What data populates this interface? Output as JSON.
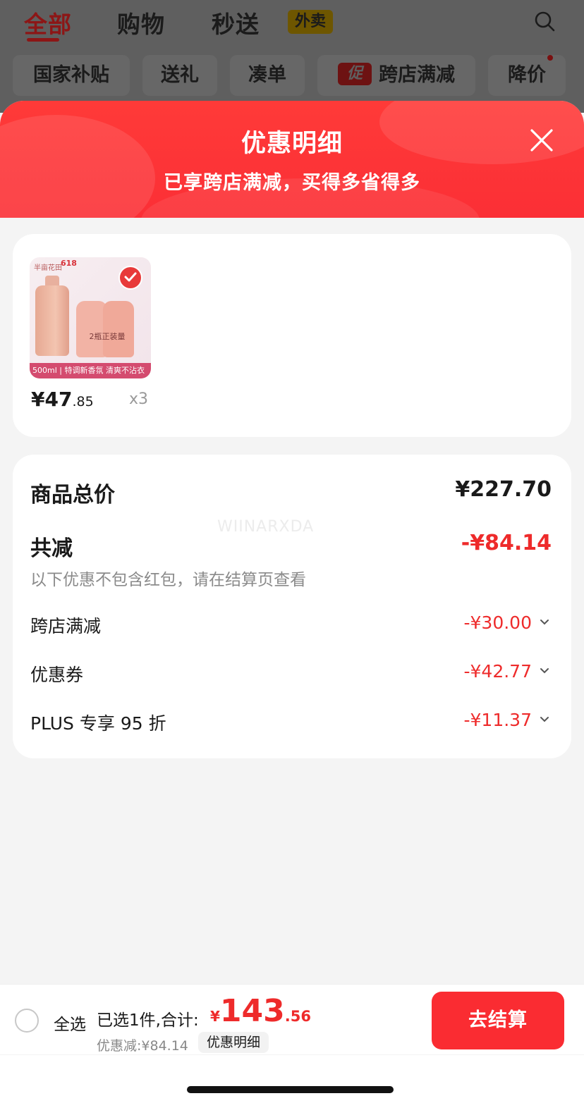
{
  "top_tabs": [
    {
      "label": "全部"
    },
    {
      "label": "购物"
    },
    {
      "label": "秒送"
    }
  ],
  "tab_badge": "外卖",
  "chips": [
    {
      "label": "国家补贴"
    },
    {
      "label": "送礼"
    },
    {
      "label": "凑单"
    },
    {
      "label": "跨店满减",
      "tag": "促"
    },
    {
      "label": "降价"
    }
  ],
  "sheet": {
    "title": "优惠明细",
    "subtitle": "已享跨店满减，买得多省得多"
  },
  "product": {
    "image_text": {
      "brand": "半亩花田",
      "promo": "618",
      "mid": "2瓶正装量",
      "bar": "500ml | 特调新香氛 清爽不沾衣"
    },
    "price_int": "¥47",
    "price_dec": ".85",
    "quantity": "x3"
  },
  "summary": {
    "total_label": "商品总价",
    "total_value": "¥227.70",
    "reduce_label": "共减",
    "reduce_value": "-¥84.14",
    "note": "以下优惠不包含红包，请在结算页查看",
    "watermark": "WIINARXDA",
    "details": [
      {
        "label": "跨店满减",
        "value": "-¥30.00"
      },
      {
        "label": "优惠券",
        "value": "-¥42.77"
      },
      {
        "label": "PLUS 专享 95 折",
        "value": "-¥11.37"
      }
    ]
  },
  "bottom": {
    "select_all": "全选",
    "selected_text": "已选1件,合计:",
    "currency": "¥",
    "total_int": "143",
    "total_dec": ".56",
    "saved": "优惠减:¥84.14",
    "detail_pill": "优惠明细",
    "checkout": "去结算"
  },
  "colors": {
    "accent": "#fa2c32",
    "discount": "#ee2b2b"
  }
}
